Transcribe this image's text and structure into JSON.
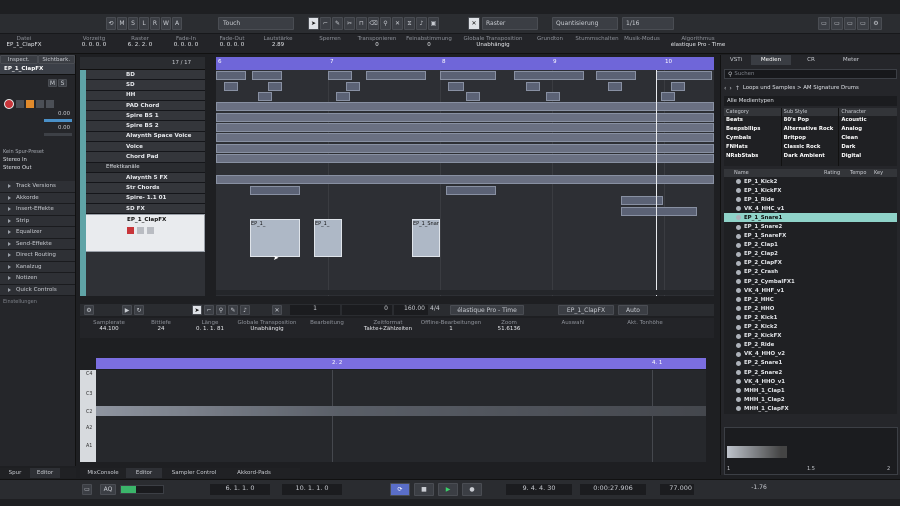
{
  "toolbar": {
    "buttons": [
      "⟲",
      "M",
      "S",
      "L",
      "R",
      "W",
      "A"
    ],
    "automation_mode": "Touch",
    "snap_type": "Raster",
    "quantize": "Quantisierung",
    "quantize_value": "1/16"
  },
  "infobar": {
    "columns": [
      {
        "label": "Datei",
        "value": "EP_1_ClapFX"
      },
      {
        "label": "Vorzeitg",
        "value": "0. 0. 0. 0"
      },
      {
        "label": "Raster",
        "value": "6. 2. 2. 0"
      },
      {
        "label": "Fade-In",
        "value": "0. 0. 0. 0"
      },
      {
        "label": "Fade-Out",
        "value": "0. 0. 0. 0"
      },
      {
        "label": "Lautstärke",
        "value": "2.89"
      },
      {
        "label": "Sperren",
        "value": ""
      },
      {
        "label": "Transponieren",
        "value": "0"
      },
      {
        "label": "Feinabstimmung",
        "value": "0"
      },
      {
        "label": "Globale Transposition",
        "value": "Unabhängig"
      },
      {
        "label": "Grundton",
        "value": ""
      },
      {
        "label": "Stummschalten",
        "value": ""
      },
      {
        "label": "Musik-Modus",
        "value": ""
      },
      {
        "label": "Algorithmus",
        "value": "élastique Pro - Time"
      }
    ]
  },
  "inspector": {
    "tabs": [
      "Inspect.",
      "Sichtbark."
    ],
    "track_name": "EP_1_ClapFX",
    "volume": "0.00",
    "pan": "0.00",
    "input_routing": "Kein Spur-Preset",
    "routing_in": "Stereo In",
    "routing_out": "Stereo Out",
    "sections": [
      "Track Versions",
      "Akkorde",
      "Insert-Effekte",
      "Strip",
      "Equalizer",
      "Send-Effekte",
      "Direct Routing",
      "Kanalzug",
      "Notizen",
      "Quick Controls"
    ],
    "footer": "Einstellungen",
    "bottom_tabs": [
      "Spur",
      "Editor"
    ]
  },
  "project": {
    "track_count": "17 / 17",
    "ruler_marks": [
      "6",
      "7",
      "8",
      "9",
      "10"
    ],
    "tracks": [
      "BD",
      "SD",
      "HH",
      "PAD Chord",
      "Spire BS 1",
      "Spire BS 2",
      "Alwynth Space Voice",
      "Voice",
      "Chord Pad",
      "Effektkanäle",
      "Alwynth 5 FX",
      "Str Chords",
      "Spire- 1.1 01",
      "SD FX",
      "EP_1_ClapFX"
    ],
    "selected_track": "EP_1_ClapFX",
    "clip_labels": [
      "EP_1_",
      "EP_1_",
      "EP_1_Snar"
    ]
  },
  "editor": {
    "position": "1",
    "offset": "0",
    "tempo": "160.00",
    "signature": "4/4",
    "algorithm": "élastique Pro - Time",
    "track_select": "EP_1_ClapFX",
    "auto_mode": "Auto",
    "info": [
      {
        "label": "Samplerate",
        "value": "44.100"
      },
      {
        "label": "Bittiefe",
        "value": "24"
      },
      {
        "label": "Länge",
        "value": "0. 1. 1. 81"
      },
      {
        "label": "Globale Transposition",
        "value": "Unabhängig"
      },
      {
        "label": "Bearbeitung",
        "value": ""
      },
      {
        "label": "Zeitformat",
        "value": "Takte+Zählzeiten"
      },
      {
        "label": "Offline-Bearbeitungen",
        "value": "1"
      },
      {
        "label": "Zoom",
        "value": "51.6136"
      },
      {
        "label": "Auswahl",
        "value": ""
      },
      {
        "label": "Akt. Tonhöhe",
        "value": ""
      }
    ],
    "ruler": [
      "2. 2",
      "4. 1"
    ],
    "keys": [
      "C4",
      "C3",
      "C2",
      "A2",
      "A1"
    ],
    "bottom_tabs": [
      "MixConsole",
      "Editor",
      "Sampler Control",
      "Akkord-Pads"
    ]
  },
  "media": {
    "tabs": [
      "VSTi",
      "Medien",
      "CR",
      "Meter"
    ],
    "search_placeholder": "Suchen",
    "breadcrumb": "Loops und Samples > AM Signature Drums",
    "filter": "Alle Medientypen",
    "cat_headers": [
      "Category",
      "Sub Style",
      "Character"
    ],
    "categories": [
      "Beats",
      "Beepsbllips",
      "Cymbals",
      "FNHats",
      "NRsbStabs"
    ],
    "substyles": [
      "80's Pop",
      "Alternative Rock",
      "Britpop",
      "Classic Rock",
      "Dark Ambient"
    ],
    "characters": [
      "Acoustic",
      "Analog",
      "Clean",
      "Dark",
      "Digital"
    ],
    "list_headers": [
      "Name",
      "Rating",
      "Tempo",
      "Key"
    ],
    "files": [
      "EP_1_Kick2",
      "EP_1_KickFX",
      "EP_1_Ride",
      "VK_4_HHC_v1",
      "EP_1_Snare1",
      "EP_1_Snare2",
      "EP_1_SnareFX",
      "EP_2_Clap1",
      "EP_2_Clap2",
      "EP_2_ClapFX",
      "EP_2_Crash",
      "EP_2_CymbalFX1",
      "VK_4_HHF_v1",
      "EP_2_HHC",
      "EP_2_HHO",
      "EP_2_Kick1",
      "EP_2_Kick2",
      "EP_2_KickFX",
      "EP_2_Ride",
      "VK_4_HHO_v2",
      "EP_2_Snare1",
      "EP_2_Snare2",
      "VK_4_HHO_v1",
      "MHH_1_Clap1",
      "MHH_1_Clap2",
      "MHH_1_ClapFX"
    ],
    "selected_file": "EP_1_Snare1",
    "preview_ruler": [
      "1",
      "1.5",
      "2"
    ]
  },
  "transport": {
    "aq": "AQ",
    "left_locator": "6. 1. 1. 0",
    "right_locator": "10. 1. 1. 0",
    "position_bars": "9. 4. 4. 30",
    "position_time": "0:00:27.906",
    "tempo": "77.000",
    "level": "-1.76"
  }
}
